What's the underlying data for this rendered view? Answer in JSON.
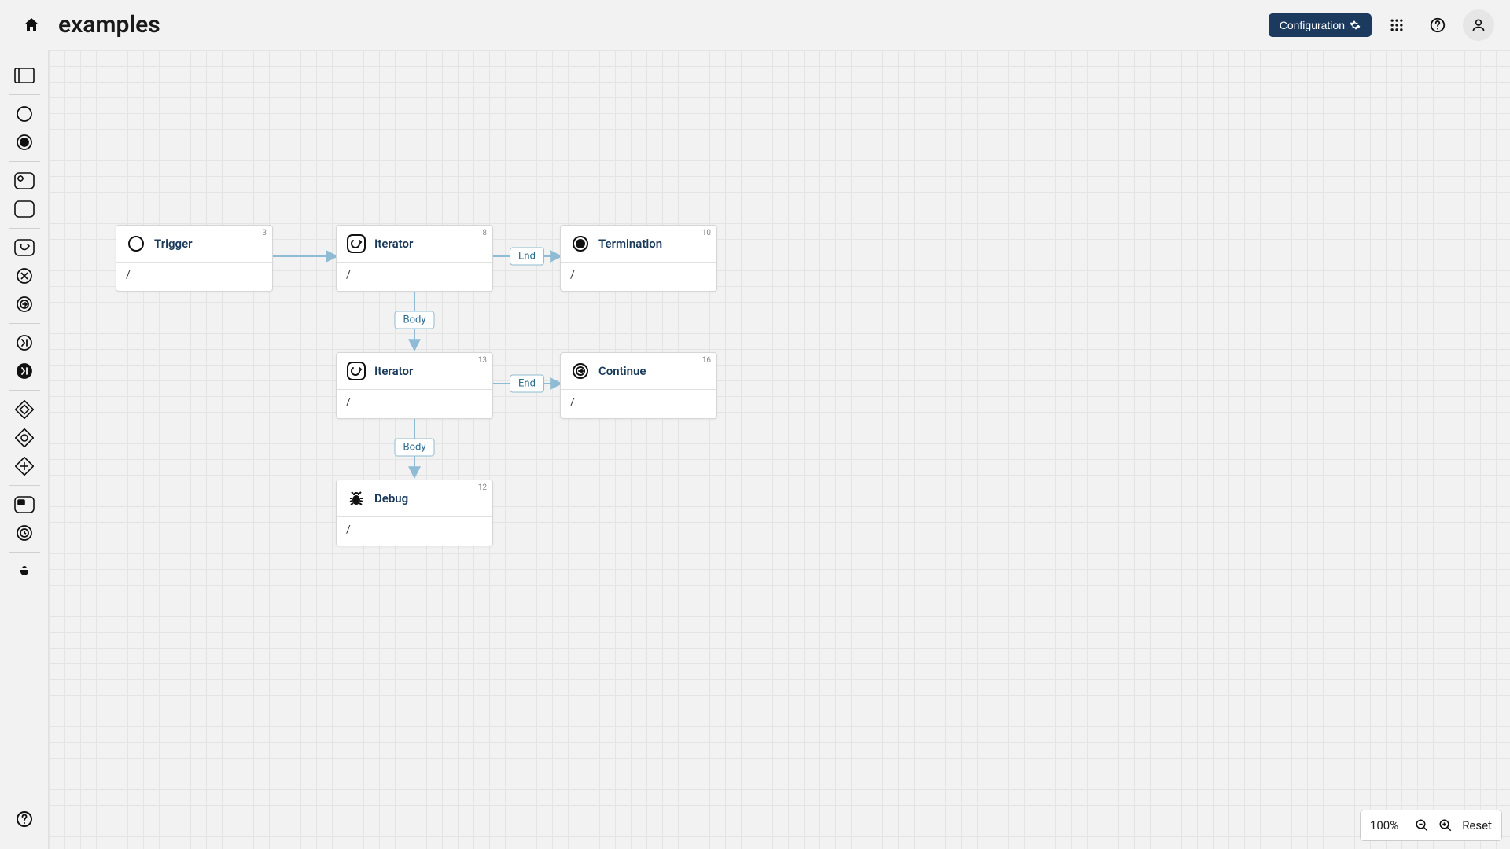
{
  "header": {
    "title": "examples",
    "config_label": "Configuration"
  },
  "nodes": {
    "trigger": {
      "title": "Trigger",
      "id": "3",
      "body": "/"
    },
    "iterator1": {
      "title": "Iterator",
      "id": "8",
      "body": "/"
    },
    "termination": {
      "title": "Termination",
      "id": "10",
      "body": "/"
    },
    "iterator2": {
      "title": "Iterator",
      "id": "13",
      "body": "/"
    },
    "continue": {
      "title": "Continue",
      "id": "16",
      "body": "/"
    },
    "debug": {
      "title": "Debug",
      "id": "12",
      "body": "/"
    }
  },
  "edges": {
    "end1": "End",
    "body1": "Body",
    "end2": "End",
    "body2": "Body"
  },
  "zoom": {
    "value": "100%",
    "reset_label": "Reset"
  }
}
